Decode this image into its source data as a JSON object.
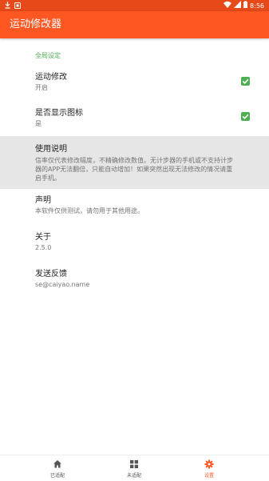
{
  "status_bar": {
    "time": "8:56",
    "icons": [
      "download-icon",
      "notification-icon",
      "wifi-icon",
      "signal-icon",
      "battery-icon"
    ]
  },
  "app_bar": {
    "title": "运动修改器"
  },
  "settings": {
    "section_header": "全局设定",
    "items": [
      {
        "title": "运动修改",
        "summary": "开启",
        "checked": true
      },
      {
        "title": "是否显示图标",
        "summary": "是",
        "checked": true
      },
      {
        "title": "使用说明",
        "summary_lines": [
          "信率仅代表修改幅度，不精确修改数值。无计步器的手机或不支持计步",
          "器的APP无法翻倍，只能自动增加！如果突然出现无法修改的情况请重",
          "启手机。"
        ]
      },
      {
        "title": "声明",
        "summary": "本软件仅供测试，请勿用于其他用途。"
      },
      {
        "title": "关于",
        "summary": "2.5.0"
      },
      {
        "title": "发送反馈",
        "summary": "se@caiyao.name"
      }
    ]
  },
  "bottom_nav": {
    "items": [
      {
        "label": "已适配",
        "icon": "home-icon",
        "active": false
      },
      {
        "label": "未适配",
        "icon": "grid-icon",
        "active": false
      },
      {
        "label": "设置",
        "icon": "gear-icon",
        "active": true
      }
    ]
  },
  "colors": {
    "primary": "#ff5722",
    "primary_dark": "#e64a19",
    "accent_green": "#4caf50",
    "highlight_bg": "#e6e6e6"
  }
}
